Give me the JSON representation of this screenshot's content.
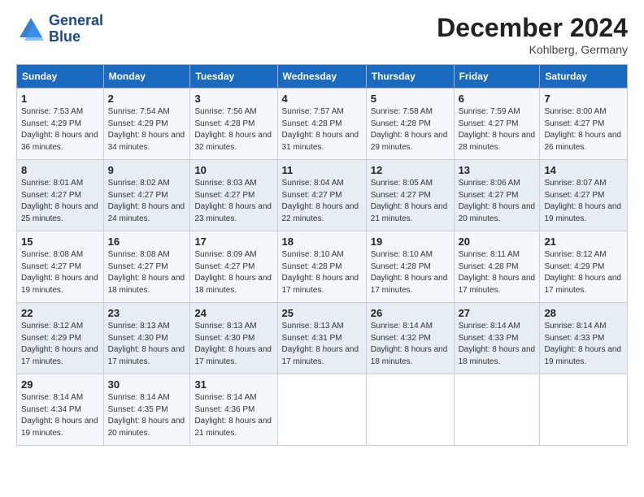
{
  "header": {
    "logo_line1": "General",
    "logo_line2": "Blue",
    "month_title": "December 2024",
    "location": "Kohlberg, Germany"
  },
  "days_of_week": [
    "Sunday",
    "Monday",
    "Tuesday",
    "Wednesday",
    "Thursday",
    "Friday",
    "Saturday"
  ],
  "weeks": [
    [
      {
        "day": 1,
        "sunrise": "7:53 AM",
        "sunset": "4:29 PM",
        "daylight": "8 hours and 36 minutes."
      },
      {
        "day": 2,
        "sunrise": "7:54 AM",
        "sunset": "4:29 PM",
        "daylight": "8 hours and 34 minutes."
      },
      {
        "day": 3,
        "sunrise": "7:56 AM",
        "sunset": "4:28 PM",
        "daylight": "8 hours and 32 minutes."
      },
      {
        "day": 4,
        "sunrise": "7:57 AM",
        "sunset": "4:28 PM",
        "daylight": "8 hours and 31 minutes."
      },
      {
        "day": 5,
        "sunrise": "7:58 AM",
        "sunset": "4:28 PM",
        "daylight": "8 hours and 29 minutes."
      },
      {
        "day": 6,
        "sunrise": "7:59 AM",
        "sunset": "4:27 PM",
        "daylight": "8 hours and 28 minutes."
      },
      {
        "day": 7,
        "sunrise": "8:00 AM",
        "sunset": "4:27 PM",
        "daylight": "8 hours and 26 minutes."
      }
    ],
    [
      {
        "day": 8,
        "sunrise": "8:01 AM",
        "sunset": "4:27 PM",
        "daylight": "8 hours and 25 minutes."
      },
      {
        "day": 9,
        "sunrise": "8:02 AM",
        "sunset": "4:27 PM",
        "daylight": "8 hours and 24 minutes."
      },
      {
        "day": 10,
        "sunrise": "8:03 AM",
        "sunset": "4:27 PM",
        "daylight": "8 hours and 23 minutes."
      },
      {
        "day": 11,
        "sunrise": "8:04 AM",
        "sunset": "4:27 PM",
        "daylight": "8 hours and 22 minutes."
      },
      {
        "day": 12,
        "sunrise": "8:05 AM",
        "sunset": "4:27 PM",
        "daylight": "8 hours and 21 minutes."
      },
      {
        "day": 13,
        "sunrise": "8:06 AM",
        "sunset": "4:27 PM",
        "daylight": "8 hours and 20 minutes."
      },
      {
        "day": 14,
        "sunrise": "8:07 AM",
        "sunset": "4:27 PM",
        "daylight": "8 hours and 19 minutes."
      }
    ],
    [
      {
        "day": 15,
        "sunrise": "8:08 AM",
        "sunset": "4:27 PM",
        "daylight": "8 hours and 19 minutes."
      },
      {
        "day": 16,
        "sunrise": "8:08 AM",
        "sunset": "4:27 PM",
        "daylight": "8 hours and 18 minutes."
      },
      {
        "day": 17,
        "sunrise": "8:09 AM",
        "sunset": "4:27 PM",
        "daylight": "8 hours and 18 minutes."
      },
      {
        "day": 18,
        "sunrise": "8:10 AM",
        "sunset": "4:28 PM",
        "daylight": "8 hours and 17 minutes."
      },
      {
        "day": 19,
        "sunrise": "8:10 AM",
        "sunset": "4:28 PM",
        "daylight": "8 hours and 17 minutes."
      },
      {
        "day": 20,
        "sunrise": "8:11 AM",
        "sunset": "4:28 PM",
        "daylight": "8 hours and 17 minutes."
      },
      {
        "day": 21,
        "sunrise": "8:12 AM",
        "sunset": "4:29 PM",
        "daylight": "8 hours and 17 minutes."
      }
    ],
    [
      {
        "day": 22,
        "sunrise": "8:12 AM",
        "sunset": "4:29 PM",
        "daylight": "8 hours and 17 minutes."
      },
      {
        "day": 23,
        "sunrise": "8:13 AM",
        "sunset": "4:30 PM",
        "daylight": "8 hours and 17 minutes."
      },
      {
        "day": 24,
        "sunrise": "8:13 AM",
        "sunset": "4:30 PM",
        "daylight": "8 hours and 17 minutes."
      },
      {
        "day": 25,
        "sunrise": "8:13 AM",
        "sunset": "4:31 PM",
        "daylight": "8 hours and 17 minutes."
      },
      {
        "day": 26,
        "sunrise": "8:14 AM",
        "sunset": "4:32 PM",
        "daylight": "8 hours and 18 minutes."
      },
      {
        "day": 27,
        "sunrise": "8:14 AM",
        "sunset": "4:33 PM",
        "daylight": "8 hours and 18 minutes."
      },
      {
        "day": 28,
        "sunrise": "8:14 AM",
        "sunset": "4:33 PM",
        "daylight": "8 hours and 19 minutes."
      }
    ],
    [
      {
        "day": 29,
        "sunrise": "8:14 AM",
        "sunset": "4:34 PM",
        "daylight": "8 hours and 19 minutes."
      },
      {
        "day": 30,
        "sunrise": "8:14 AM",
        "sunset": "4:35 PM",
        "daylight": "8 hours and 20 minutes."
      },
      {
        "day": 31,
        "sunrise": "8:14 AM",
        "sunset": "4:36 PM",
        "daylight": "8 hours and 21 minutes."
      },
      null,
      null,
      null,
      null
    ]
  ],
  "labels": {
    "sunrise": "Sunrise:",
    "sunset": "Sunset:",
    "daylight": "Daylight:"
  }
}
